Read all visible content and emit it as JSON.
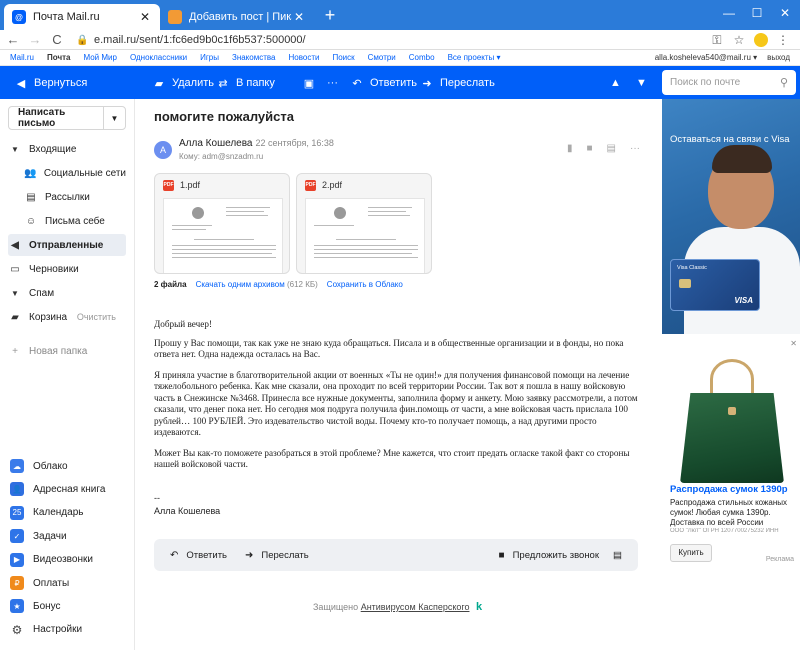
{
  "browser": {
    "tabs": [
      {
        "title": "Почта Mail.ru",
        "favicon": "mail-ru-favicon",
        "active": true
      },
      {
        "title": "Добавить пост | Пикабу",
        "favicon": "pikabu-favicon",
        "active": false
      }
    ],
    "new_tab": "+",
    "window_controls": {
      "minimize": "—",
      "maximize": "☐",
      "close": "✕"
    },
    "url": "e.mail.ru/sent/1:fc6ed9b0c1f6b537:500000/",
    "nav": {
      "back": "←",
      "forward": "→",
      "reload": "C"
    }
  },
  "portal": {
    "links": [
      "Mail.ru",
      "Почта",
      "Мой Мир",
      "Одноклассники",
      "Игры",
      "Знакомства",
      "Новости",
      "Поиск",
      "Смотри",
      "Combo",
      "Все проекты ▾"
    ],
    "current_index": 1,
    "user_email": "alla.kosheleva540@mail.ru ▾",
    "logout": "выход"
  },
  "toolbar": {
    "back": "Вернуться",
    "delete": "Удалить",
    "to_folder": "В папку",
    "more": "···",
    "reply": "Ответить",
    "forward": "Переслать",
    "search_placeholder": "Поиск по почте"
  },
  "sidebar": {
    "compose": "Написать письмо",
    "folders": [
      {
        "label": "Входящие",
        "icon": "chevron-down-icon",
        "sub": false,
        "selected": false,
        "aux": ""
      },
      {
        "label": "Социальные сети",
        "icon": "people-icon",
        "sub": true,
        "selected": false,
        "aux": ""
      },
      {
        "label": "Рассылки",
        "icon": "newsletter-icon",
        "sub": true,
        "selected": false,
        "aux": ""
      },
      {
        "label": "Письма себе",
        "icon": "self-mail-icon",
        "sub": true,
        "selected": false,
        "aux": ""
      },
      {
        "label": "Отправленные",
        "icon": "sent-icon",
        "sub": false,
        "selected": true,
        "aux": ""
      },
      {
        "label": "Черновики",
        "icon": "draft-icon",
        "sub": false,
        "selected": false,
        "aux": ""
      },
      {
        "label": "Спам",
        "icon": "thumb-down-icon",
        "sub": false,
        "selected": false,
        "aux": ""
      },
      {
        "label": "Корзина",
        "icon": "trash-icon",
        "sub": false,
        "selected": false,
        "aux": "Очистить"
      }
    ],
    "new_folder": "Новая папка",
    "services": [
      {
        "label": "Облако",
        "color": "#3a7bea"
      },
      {
        "label": "Адресная книга",
        "color": "#2f6fe0"
      },
      {
        "label": "Календарь",
        "color": "#2e74e8",
        "glyph": "25"
      },
      {
        "label": "Задачи",
        "color": "#2e74e8"
      },
      {
        "label": "Видеозвонки",
        "color": "#2e74e8"
      },
      {
        "label": "Оплаты",
        "color": "#f08a1c"
      },
      {
        "label": "Бонус",
        "color": "#2e74e8"
      },
      {
        "label": "Настройки",
        "color": "#444"
      }
    ]
  },
  "message": {
    "subject": "помогите пожалуйста",
    "avatar_letter": "А",
    "sender": "Алла Кошелева",
    "date": "22 сентября, 16:38",
    "to": "Кому: adm@snzadm.ru",
    "attachments": [
      {
        "name": "1.pdf"
      },
      {
        "name": "2.pdf"
      }
    ],
    "attach_count": "2 файла",
    "download_all": "Скачать одним архивом",
    "archive_size": "(612 КБ)",
    "save_cloud": "Сохранить в Облако",
    "body": [
      "Добрый вечер!",
      "Прошу у Вас помощи, так как уже не знаю куда обращаться. Писала и в общественные организации и в фонды, но пока ответа нет. Одна надежда осталась на Вас.",
      "Я приняла участие в благотворительной акции от военных «Ты не один!» для получения финансовой помощи на лечение тяжелобольного ребенка. Как мне сказали, она проходит по всей территории России. Так вот я пошла в нашу войсковую часть в Снежинске №3468. Принесла все нужные документы, заполнила форму и анкету. Мою заявку рассмотрели, а потом сказали, что денег пока нет. Но сегодня моя подруга получила фин.помощь от части, а мне войсковая часть прислала 100 рублей… 100 РУБЛЕЙ. Это издевательство чистой воды. Почему кто-то получает помощь, а над другими просто издеваются.",
      "Может Вы как-то поможете разобраться в этой проблеме? Мне кажется, что стоит предать огласке такой факт со стороны нашей войсковой части."
    ],
    "sig_dash": "--",
    "sig_name": "Алла Кошелева",
    "reply": "Ответить",
    "forward": "Переслать",
    "suggest_call": "Предложить звонок",
    "protected": "Защищено",
    "antivirus": "Антивирусом Касперского",
    "kaspersky_mark": "k"
  },
  "ads": {
    "banner_text": "Оставаться на связи с Visa",
    "card_name": "Visa Classic",
    "card_brand": "VISA",
    "close": "✕",
    "product_title": "Распродажа сумок 1390р",
    "product_desc": "Распродажа стильных кожаных сумок! Любая сумка 1390р. Доставка по всей России",
    "legal": "ООО \"Лют\" ОГРН 1207700275232 ИНН",
    "buy": "Купить",
    "ad_label": "Реклама"
  }
}
